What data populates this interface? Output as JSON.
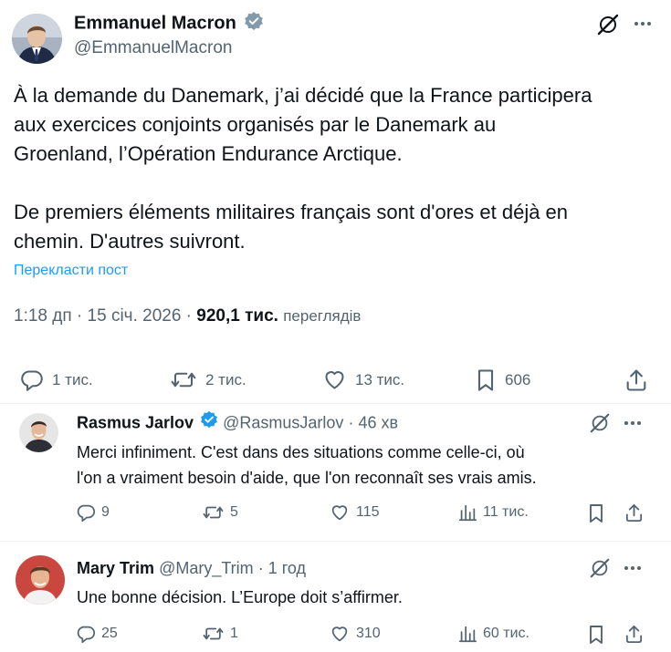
{
  "main_post": {
    "author_name": "Emmanuel Macron",
    "handle": "@EmmanuelMacron",
    "text_lines": [
      "À la demande du Danemark, j’ai décidé que la France participera",
      "aux exercices conjoints organisés par le Danemark au",
      "Groenland, l’Opération Endurance Arctique."
    ],
    "text_lines2": [
      "De premiers éléments militaires français sont d'ores et déjà en",
      "chemin. D'autres suivront."
    ],
    "translate_link": "Перекласти пост",
    "time": "1:18 дп",
    "dot": "·",
    "date": "15 січ. 2026",
    "views_count": "920,1 тис.",
    "views_label": "переглядів",
    "replies": "1 тис.",
    "reposts": "2 тис.",
    "likes": "13 тис.",
    "bookmarks": "606"
  },
  "replies": [
    {
      "author_name": "Rasmus Jarlov",
      "handle": "@RasmusJarlov",
      "sep": "·",
      "time": "46 хв",
      "text_lines": [
        "Merci infiniment. C'est dans des situations comme celle-ci, où",
        "l'on a vraiment besoin d'aide, que l'on reconnaît ses vrais amis."
      ],
      "replies": "9",
      "reposts": "5",
      "likes": "115",
      "views": "11 тис."
    },
    {
      "author_name": "Mary Trim",
      "handle": "@Mary_Trim",
      "sep": "·",
      "time": "1 год",
      "text_lines": [
        "Une bonne décision. L’Europe doit s’affirmer."
      ],
      "replies": "25",
      "reposts": "1",
      "likes": "310",
      "views": "60 тис."
    }
  ],
  "colors": {
    "text": "#0f1419",
    "muted": "#536471",
    "link": "#1d9bf0",
    "verified": "#1d9bf0",
    "divider": "#eff3f4"
  }
}
